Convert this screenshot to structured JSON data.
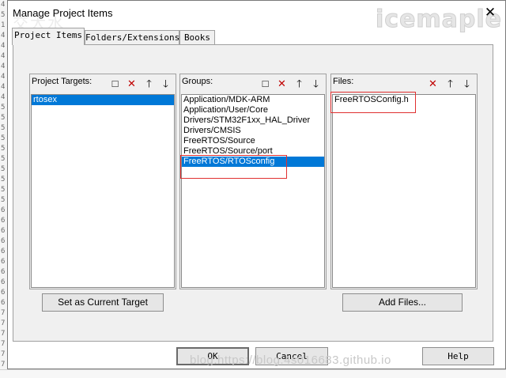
{
  "window": {
    "title": "Manage Project Items",
    "close_glyph": "✕",
    "watermark": "icemaple",
    "deco_watermark": "交大水"
  },
  "gutter": {
    "lines": [
      "4",
      "5",
      "1",
      "4",
      "4",
      "4",
      "4",
      "4",
      "4",
      "4",
      "5",
      "5",
      "5",
      "5",
      "5",
      "5",
      "5",
      "5",
      "5",
      "5",
      "6",
      "6",
      "6",
      "6",
      "6",
      "6",
      "6",
      "6",
      "6",
      "6",
      "7",
      "7",
      "7",
      "7",
      "7",
      "7"
    ]
  },
  "tabs": [
    "Project Items",
    "Folders/Extensions",
    "Books"
  ],
  "targets": {
    "header": "Project Targets:",
    "items": [
      "rtosex"
    ],
    "selected_index": 0,
    "set_current_button": "Set as Current Target"
  },
  "groups": {
    "header": "Groups:",
    "items": [
      "Application/MDK-ARM",
      "Application/User/Core",
      "Drivers/STM32F1xx_HAL_Driver",
      "Drivers/CMSIS",
      "FreeRTOS/Source",
      "FreeRTOS/Source/port",
      "FreeRTOS/RTOSconfig"
    ],
    "selected_index": 6
  },
  "files": {
    "header": "Files:",
    "items": [
      "FreeRTOSConfig.h"
    ],
    "add_files_button": "Add Files..."
  },
  "icons": {
    "new": "□",
    "delete": "✕",
    "move_up": "🡑",
    "move_down": "🡓"
  },
  "footer": {
    "ok": "OK",
    "cancel": "Cancel",
    "help": "Help",
    "watermark": "blog.https://blog.4s016683.github.io"
  },
  "colors": {
    "selection": "#0078d7",
    "delete_icon": "#c00000",
    "annotation_box": "#e03030"
  }
}
